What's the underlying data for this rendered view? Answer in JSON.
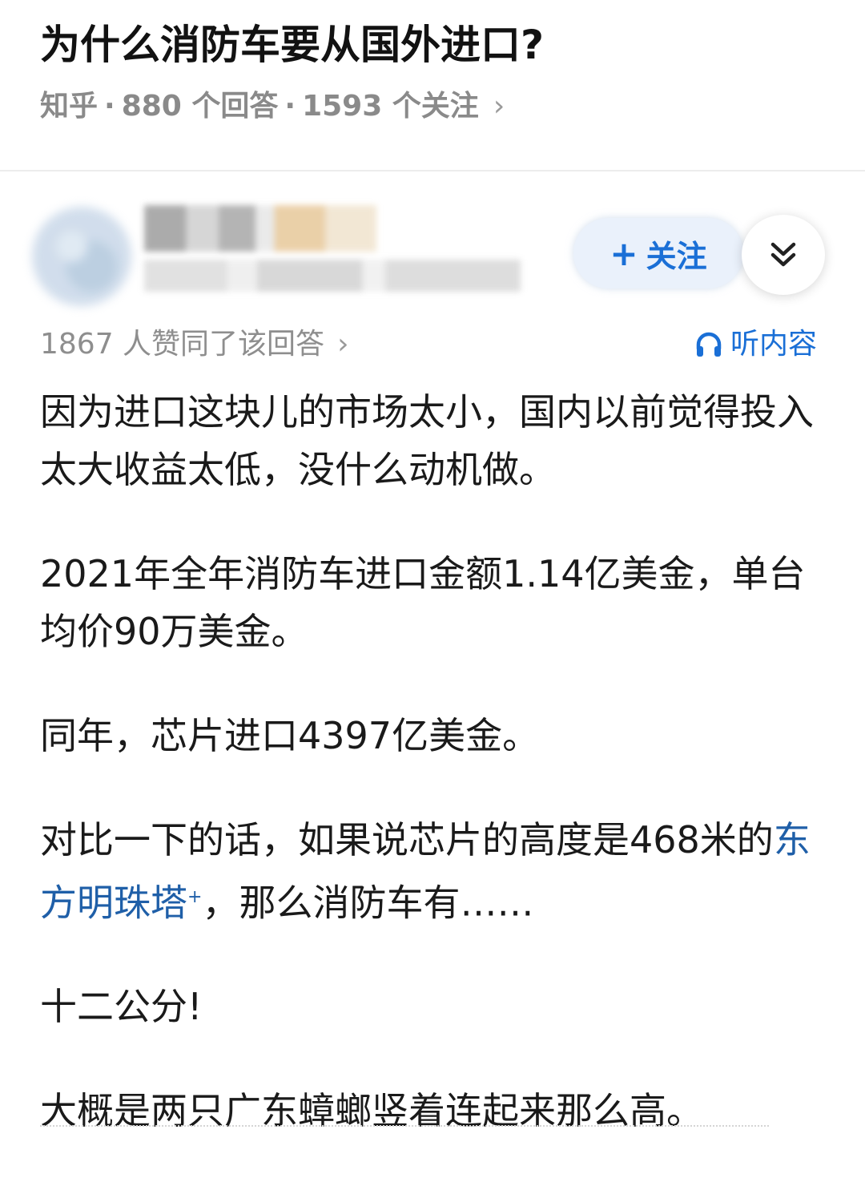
{
  "question": {
    "title": "为什么消防车要从国外进口?",
    "source": "知乎",
    "answers_count": "880 个回答",
    "followers_count": "1593 个关注",
    "separator": "·",
    "chevron": "›"
  },
  "author": {
    "follow_label": "关注",
    "follow_plus": "+",
    "more_icon": "double-chevron-down-icon"
  },
  "answer": {
    "vote_text": "1867 人赞同了该回答",
    "vote_chevron": "›",
    "listen_label": "听内容",
    "paragraphs": [
      "因为进口这块儿的市场太小，国内以前觉得投入太大收益太低，没什么动机做。",
      "2021年全年消防车进口金额1.14亿美金，单台均价90万美金。",
      "同年，芯片进口4397亿美金。"
    ],
    "compare_prefix": "对比一下的话，如果说芯片的高度是468米的",
    "compare_link": "东方明珠塔",
    "compare_link_mark": "+",
    "compare_suffix": "，那么消防车有……",
    "paragraph_5": "十二公分!",
    "paragraph_6": "大概是两只广东蟑螂竖着连起来那么高。"
  },
  "colors": {
    "accent": "#1a6fd6",
    "link": "#1f5fa8",
    "meta": "#8a8a8a"
  }
}
